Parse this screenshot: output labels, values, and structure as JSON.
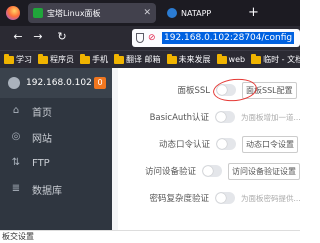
{
  "browser": {
    "tabs": [
      {
        "title": "宝塔Linux面板",
        "active": true
      },
      {
        "title": "NATAPP",
        "active": false
      }
    ],
    "url": "192.168.0.102:28704/config",
    "bookmarks": [
      "学习",
      "程序员",
      "手机",
      "翻译 邮箱",
      "未来发展",
      "web",
      "临时 - 文档"
    ]
  },
  "sidebar": {
    "server": "192.168.0.102",
    "badge": "0",
    "items": [
      {
        "label": "首页",
        "icon": "home-icon"
      },
      {
        "label": "网站",
        "icon": "globe-icon"
      },
      {
        "label": "FTP",
        "icon": "ftp-icon"
      },
      {
        "label": "数据库",
        "icon": "database-icon"
      }
    ]
  },
  "settings": {
    "rows": [
      {
        "label": "面板SSL",
        "button": "面板SSL配置",
        "desc": ""
      },
      {
        "label": "BasicAuth认证",
        "button": "",
        "desc": "为面板增加一道..."
      },
      {
        "label": "动态口令认证",
        "button": "动态口令设置",
        "desc": ""
      },
      {
        "label": "访问设备验证",
        "button": "访问设备验证设置",
        "desc": ""
      },
      {
        "label": "密码复杂度验证",
        "button": "",
        "desc": "为面板密码提供..."
      }
    ]
  },
  "footer": {
    "text": "板交设置"
  }
}
